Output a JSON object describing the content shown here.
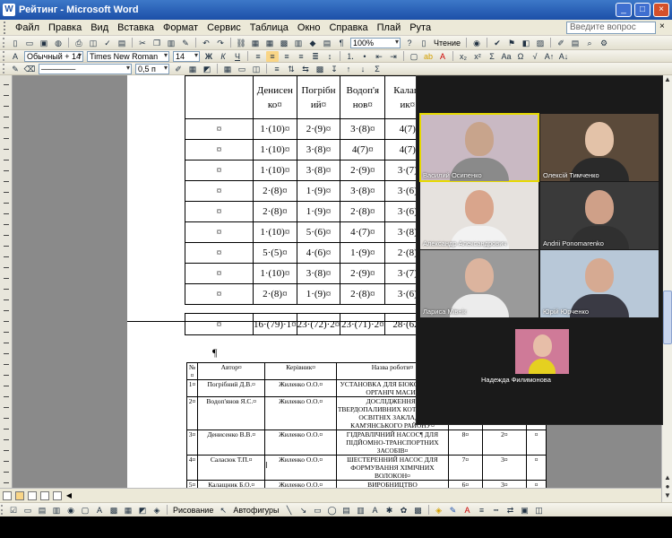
{
  "window": {
    "title": "Рейтинг - Microsoft Word",
    "app_icon": "W"
  },
  "menu": {
    "items": [
      "Файл",
      "Правка",
      "Вид",
      "Вставка",
      "Формат",
      "Сервис",
      "Таблица",
      "Окно",
      "Справка",
      "Плай",
      "Рута"
    ],
    "help_placeholder": "Введите вопрос",
    "help_close": "×"
  },
  "toolbar": {
    "zoom": "100%",
    "reading": "Чтение",
    "style": "Обычный + 14 пт,",
    "font": "Times New Roman",
    "font_size": "14",
    "line_width": "0,5 п",
    "drawing": "Рисование",
    "autoshapes": "Автофигуры"
  },
  "rating_table": {
    "headers": [
      "",
      "Денисен\nко¤",
      "Погрібн\nий¤",
      "Водоп'я\nнов¤",
      "Калащ\nик¤"
    ],
    "rows": [
      [
        "¤",
        "1·(10)¤",
        "2·(9)¤",
        "3·(8)¤",
        "4(7)"
      ],
      [
        "¤",
        "1·(10)¤",
        "3·(8)¤",
        "4(7)¤",
        "4(7)"
      ],
      [
        "¤",
        "1·(10)¤",
        "3·(8)¤",
        "2·(9)¤",
        "3·(7)"
      ],
      [
        "¤",
        "2·(8)¤",
        "1·(9)¤",
        "3·(8)¤",
        "3·(6)"
      ],
      [
        "¤",
        "2·(8)¤",
        "1·(9)¤",
        "2·(8)¤",
        "3·(6)"
      ],
      [
        "¤",
        "1·(10)¤",
        "5·(6)¤",
        "4·(7)¤",
        "3·(8)"
      ],
      [
        "¤",
        "5·(5)¤",
        "4·(6)¤",
        "1·(9)¤",
        "2·(8)"
      ],
      [
        "¤",
        "1·(10)¤",
        "3·(8)¤",
        "2·(9)¤",
        "3·(7)"
      ],
      [
        "¤",
        "2·(8)¤",
        "1·(9)¤",
        "2·(8)¤",
        "3·(6)"
      ]
    ],
    "sum_row": [
      "¤",
      "16·(79)·1¤",
      "23·(72)·2¤",
      "23·(71)·2¤",
      "28·(62)"
    ]
  },
  "pilcrow": "¶",
  "works_table": {
    "header": [
      "№¤",
      "Автор¤",
      "Керівник¤",
      "Назва роботи¤",
      "",
      "",
      ""
    ],
    "rows": [
      [
        "1¤",
        "Погрібний Д.В.¤",
        "Жиленко О.О.¤",
        "УСТАНОВКА ДЛЯ БІОКОНВЕРСІЇ ОРГАНІЧ МАСИ¤",
        "",
        "",
        ""
      ],
      [
        "2¤",
        "Водоп'янов Я.С.¤",
        "Жиленко О.О.¤",
        "ДОСЛІДЖЕННЯ¶ ТВЕРДОПАЛИВНИХ КОТ УМОВАХ ОСВІТНІХ ЗАКЛАДІВ КАМ'ЯНСЬКОГО РАЙОНУ¤",
        "",
        "",
        ""
      ],
      [
        "3¤",
        "Денисенко В.В.¤",
        "Жиленко О.О.¤",
        "ГІДРАВЛІЧНИЙ НАСОС¶ ДЛЯ ПІДЙОМНО-ТРАНСПОРТНИХ ЗАСОБІВ¤",
        "8¤",
        "2¤",
        "¤"
      ],
      [
        "4¤",
        "Саласюк Т.П.¤",
        "Жиленко О.О.¤",
        "ШЕСТЕРЕННИЙ НАСОС ДЛЯ ФОРМУВАННЯ ХІМІЧНИХ ВОЛОКОН¤",
        "7¤",
        "3¤",
        "¤"
      ],
      [
        "5¤",
        "Калащник Б.О.¤",
        "Жиленко О.О.¤",
        "ВИРОБНИЦТВО",
        "6¤",
        "3¤",
        "¤"
      ]
    ]
  },
  "zoom_participants": [
    {
      "name": "Василий Осипенко",
      "active": true,
      "bg": "#c9b9c3",
      "skin": "#c8a48c",
      "shirt": "#8a8a8a"
    },
    {
      "name": "Олексій Тимченко",
      "active": false,
      "bg": "#5b4a3a",
      "skin": "#e3c2a8",
      "shirt": "#2a2a2a"
    },
    {
      "name": "Александр Александрович",
      "active": false,
      "bg": "#e6e2de",
      "skin": "#d9a58c",
      "shirt": "#f2f2f2"
    },
    {
      "name": "Andrii Ponomarenko",
      "active": false,
      "bg": "#3a3a3a",
      "skin": "#cfa088",
      "shirt": "#303030"
    },
    {
      "name": "Лариса Мівнік",
      "active": false,
      "bg": "#9a9a9a",
      "skin": "#dcb49e",
      "shirt": "#ececec"
    },
    {
      "name": "Юрій Юрченко",
      "active": false,
      "bg": "#b8c8d8",
      "skin": "#d6aa92",
      "shirt": "#3a3a44"
    },
    {
      "name": "Надежда Филимонова",
      "active": false,
      "bg": "#cf7a98",
      "skin": "#e7bea8",
      "shirt": "#e5d020"
    }
  ],
  "colors": {
    "title_bar": "#2456a8",
    "active_speaker": "#e6d900",
    "chrome": "#ece9d8"
  }
}
